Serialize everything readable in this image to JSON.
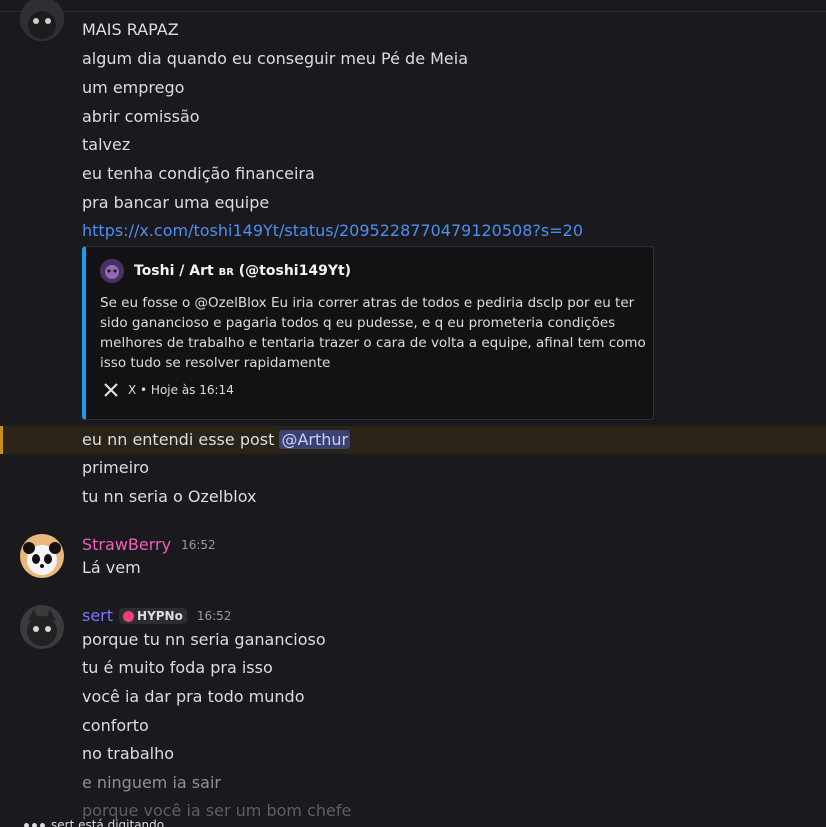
{
  "top_group": {
    "lines": [
      "MAIS RAPAZ",
      "algum dia quando eu conseguir meu Pé de Meia",
      "um emprego",
      "abrir comissão",
      "talvez",
      "eu tenha condição financeira",
      "pra bancar uma equipe"
    ],
    "link": "https://x.com/toshi149Yt/status/2095228770479120508?s=20",
    "after_embed_lines": [
      "primeiro",
      "tu nn seria o Ozelblox"
    ],
    "mention_line_text": "eu nn entendi esse post",
    "mention": "@Arthur"
  },
  "embed": {
    "author": "Toshi / Art",
    "author_badge": "BR",
    "author_handle": "(@toshi149Yt)",
    "body_lines": [
      "Se eu fosse o @OzelBlox Eu iria correr atras de todos e pediria dsclp por eu ter",
      "sido ganancioso e pagaria todos q eu pudesse, e q eu prometeria condições",
      "melhores de trabalho e tentaria trazer o cara de volta a equipe, afinal tem como",
      "isso tudo se resolver rapidamente"
    ],
    "footer": "X • Hoje às 16:14",
    "accent": "#1d9bf0"
  },
  "strawberry": {
    "username": "StrawBerry",
    "time": "16:52",
    "lines": [
      "Lá vem"
    ],
    "color": "#f05fbd"
  },
  "sert": {
    "username": "sert",
    "tag": "HYPNo",
    "time": "16:52",
    "lines": [
      "porque tu nn seria ganancioso",
      "tu é muito foda pra isso",
      "você ia dar pra todo mundo",
      "conforto",
      "no trabalho",
      "e ninguem ia sair",
      "porque você ia ser um bom chefe"
    ],
    "color": "#7c73ff"
  },
  "typing": {
    "text": "sert está digitando..."
  }
}
